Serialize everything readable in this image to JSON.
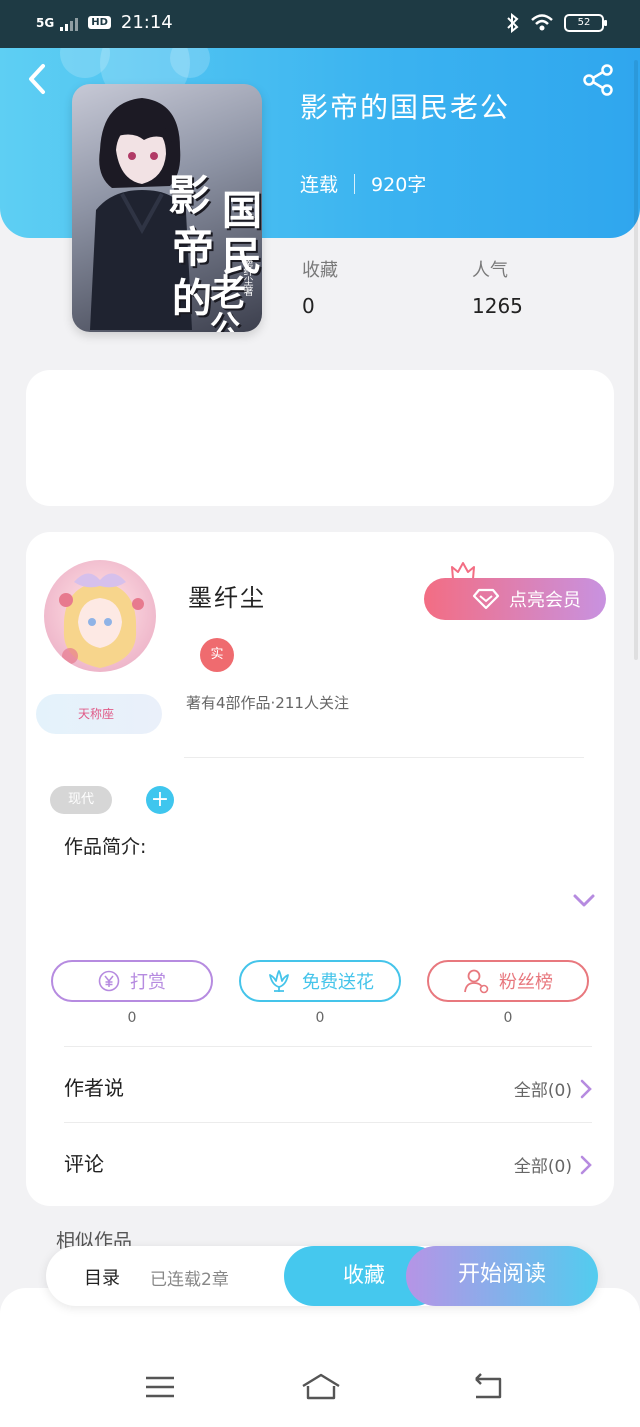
{
  "status_bar": {
    "network": "5G",
    "hd": "HD",
    "time": "21:14",
    "battery": "52"
  },
  "header": {
    "back_icon": "chevron-left-icon",
    "share_icon": "share-icon"
  },
  "book": {
    "title": "影帝的国民老公",
    "status": "连载",
    "word_count": "920字",
    "cover": {
      "title_chars": [
        "影",
        "帝",
        "的",
        "国",
        "民",
        "老",
        "公"
      ],
      "author": "墨纤尘著"
    },
    "stats": [
      {
        "label": "收藏",
        "value": "0"
      },
      {
        "label": "人气",
        "value": "1265"
      }
    ]
  },
  "author": {
    "name": "墨纤尘",
    "real_badge": "实",
    "badge_tag": "天称座",
    "info": "著有4部作品·211人关注",
    "vip_button": "点亮会员"
  },
  "tags": {
    "items": [
      "现代"
    ],
    "add_icon": "+"
  },
  "intro": {
    "label": "作品简介:"
  },
  "actions": [
    {
      "label": "打赏",
      "count": "0",
      "icon": "yen-icon",
      "color": "#b68be0"
    },
    {
      "label": "免费送花",
      "count": "0",
      "icon": "flower-icon",
      "color": "#45c4ea"
    },
    {
      "label": "粉丝榜",
      "count": "0",
      "icon": "user-icon",
      "color": "#e8787e"
    }
  ],
  "sections": [
    {
      "label": "作者说",
      "right": "全部(0)"
    },
    {
      "label": "评论",
      "right": "全部(0)"
    }
  ],
  "similar": {
    "label": "相似作品"
  },
  "bottom_bar": {
    "toc_label": "目录",
    "serial_count": "已连载2章",
    "favorite_label": "收藏",
    "start_label": "开始阅读"
  },
  "nav": {
    "menu_icon": "menu-icon",
    "home_icon": "home-icon",
    "back_icon": "back-icon"
  },
  "colors": {
    "header_gradient_start": "#5ecff3",
    "header_gradient_end": "#2fa6ee",
    "accent_pink": "#f36d83",
    "accent_purple": "#c892e0",
    "favorite_blue": "#45c8ee"
  }
}
